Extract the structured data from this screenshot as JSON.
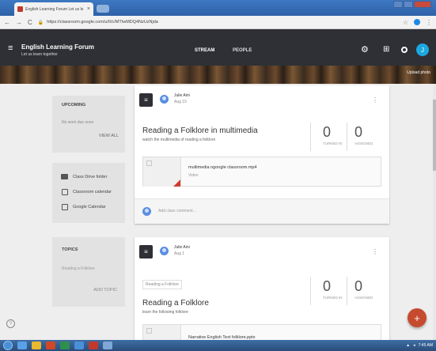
{
  "browser": {
    "tab_title": "English Learning Forum Let us le",
    "tab_close": "×",
    "url": "https://classroom.google.com/u/0/c/MTIwMDQ4NzUzNjda"
  },
  "header": {
    "class_title": "English Learning Forum",
    "class_subtitle": "Let us learn together",
    "tab_stream": "STREAM",
    "tab_people": "PEOPLE",
    "avatar_letter": "J"
  },
  "banner": {
    "upload_photo": "Upload photo"
  },
  "sidebar": {
    "upcoming_title": "UPCOMING",
    "upcoming_text": "No work due soon",
    "view_all": "VIEW ALL",
    "links": [
      {
        "label": "Class Drive folder",
        "icon": "folder-icon"
      },
      {
        "label": "Classroom calendar",
        "icon": "calendar-icon"
      },
      {
        "label": "Google Calendar",
        "icon": "external-calendar-icon"
      }
    ],
    "topics_title": "TOPICS",
    "topic_item": "Reading a Folklore",
    "add_topic": "ADD TOPIC"
  },
  "posts": [
    {
      "author": "Julie Aini",
      "date": "Aug 15",
      "title": "Reading a Folklore in multimedia",
      "description": "watch the multimedia of reading a folklore",
      "turned_in": "0",
      "turned_in_label": "TURNED IN",
      "assigned": "0",
      "assigned_label": "ASSIGNED",
      "attachment_name": "multimedia ngoogle classroom.mp4",
      "attachment_type": "Video",
      "comment_placeholder": "Add class comment..."
    },
    {
      "author": "Julie Aini",
      "date": "Aug 1",
      "topic": "Reading a Folklore",
      "title": "Reading a Folklore",
      "description": "learn the following folklore",
      "turned_in": "0",
      "turned_in_label": "TURNED IN",
      "assigned": "0",
      "assigned_label": "ASSIGNED",
      "attachment_name": "Narrative English Text folklore.pptx"
    }
  ],
  "taskbar": {
    "time": "7:45 AM"
  },
  "colors": {
    "header_bg": "#2e3036",
    "accent_fab": "#c64a2e",
    "avatar_blue": "#1ba8e0"
  }
}
